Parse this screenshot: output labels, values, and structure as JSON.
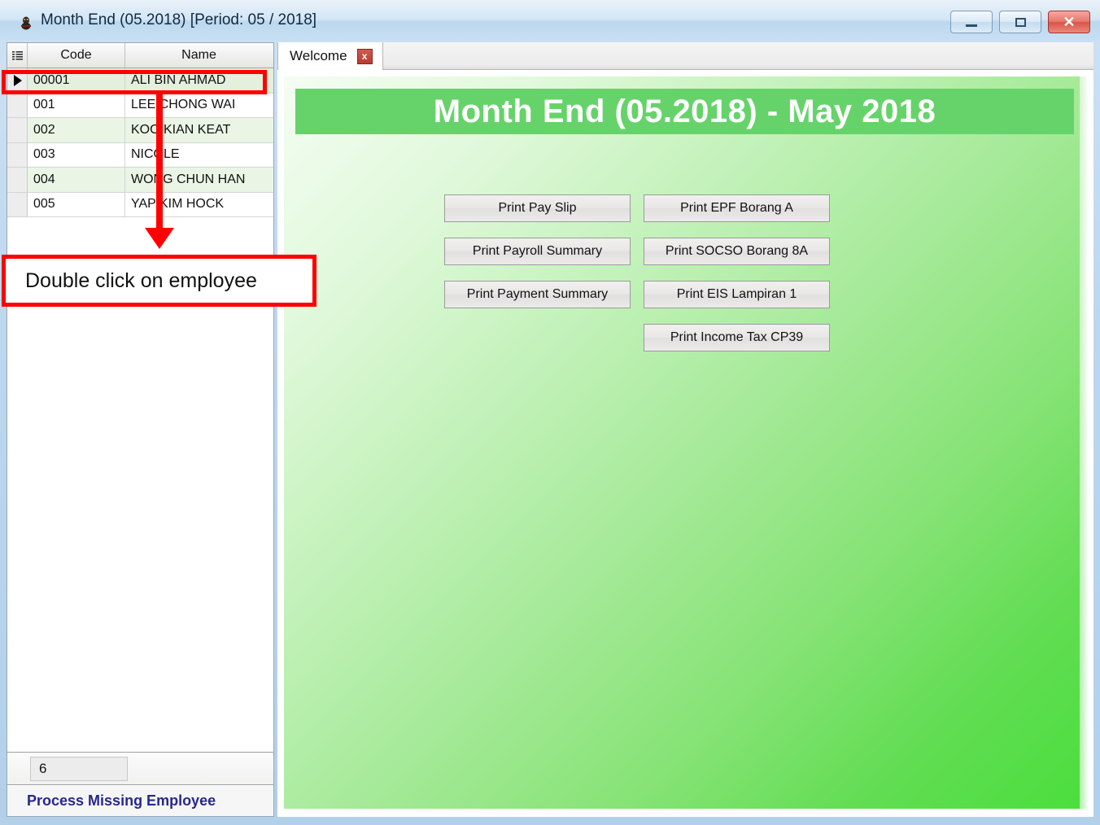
{
  "window": {
    "title": "Month End (05.2018) [Period: 05 / 2018]",
    "app_icon": "application-icon",
    "controls": {
      "minimize": "minimize-button",
      "maximize": "maximize-button",
      "close": "✕"
    }
  },
  "employee_grid": {
    "columns": [
      "Code",
      "Name"
    ],
    "header_icon": "grid-menu-icon",
    "row_marker": "▶",
    "rows": [
      {
        "code": "00001",
        "name": "ALI BIN AHMAD",
        "selected": true
      },
      {
        "code": "001",
        "name": "LEE CHONG WAI",
        "selected": false
      },
      {
        "code": "002",
        "name": "KOO KIAN KEAT",
        "selected": false
      },
      {
        "code": "003",
        "name": "NICOLE",
        "selected": false
      },
      {
        "code": "004",
        "name": "WONG CHUN HAN",
        "selected": false
      },
      {
        "code": "005",
        "name": "YAP KIM HOCK",
        "selected": false
      }
    ],
    "record_count": "6",
    "process_link": "Process Missing Employee"
  },
  "tabs": {
    "items": [
      {
        "label": "Welcome",
        "close_glyph": "x",
        "active": true
      }
    ]
  },
  "welcome": {
    "banner": "Month End (05.2018) - May 2018",
    "buttons_left": [
      "Print Pay Slip",
      "Print Payroll Summary",
      "Print Payment Summary"
    ],
    "buttons_right": [
      "Print EPF Borang A",
      "Print SOCSO Borang 8A",
      "Print EIS Lampiran 1",
      "Print Income Tax CP39"
    ]
  },
  "annotation": {
    "text": "Double click on employee",
    "color": "#ff0000"
  },
  "colors": {
    "banner_green": "#66d36a",
    "link_blue": "#27288c",
    "selection_green": "#e2f0dc",
    "alt_row_green": "#eaf5e6",
    "annotation_red": "#ff0000"
  }
}
